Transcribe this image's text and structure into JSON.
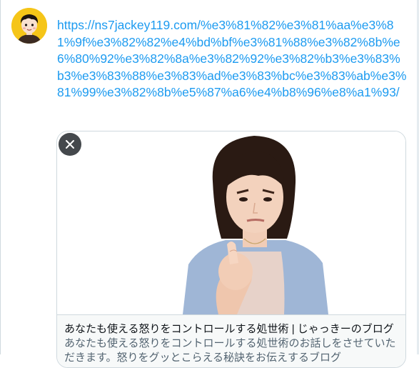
{
  "tweet": {
    "url_text": "https://ns7jackey119.com/%e3%81%82%e3%81%aa%e3%81%9f%e3%82%82%e4%bd%bf%e3%81%88%e3%82%8b%e6%80%92%e3%82%8a%e3%82%92%e3%82%b3%e3%83%b3%e3%83%88%e3%83%ad%e3%83%bc%e3%83%ab%e3%81%99%e3%82%8b%e5%87%a6%e4%b8%96%e8%a1%93/"
  },
  "card": {
    "title": "あなたも使える怒りをコントロールする処世術 | じゃっきーのブログ",
    "description": "あなたも使える怒りをコントロールする処世術のお話しをさせていただきます。怒りをグッとこらえる秘訣をお伝えするブログ"
  },
  "icons": {
    "close": "close-icon",
    "avatar": "avatar-illustration"
  },
  "colors": {
    "link": "#1d9bf0",
    "avatar_bg": "#f5c518",
    "card_border": "#cfd9de",
    "close_bg": "#0f1419"
  }
}
